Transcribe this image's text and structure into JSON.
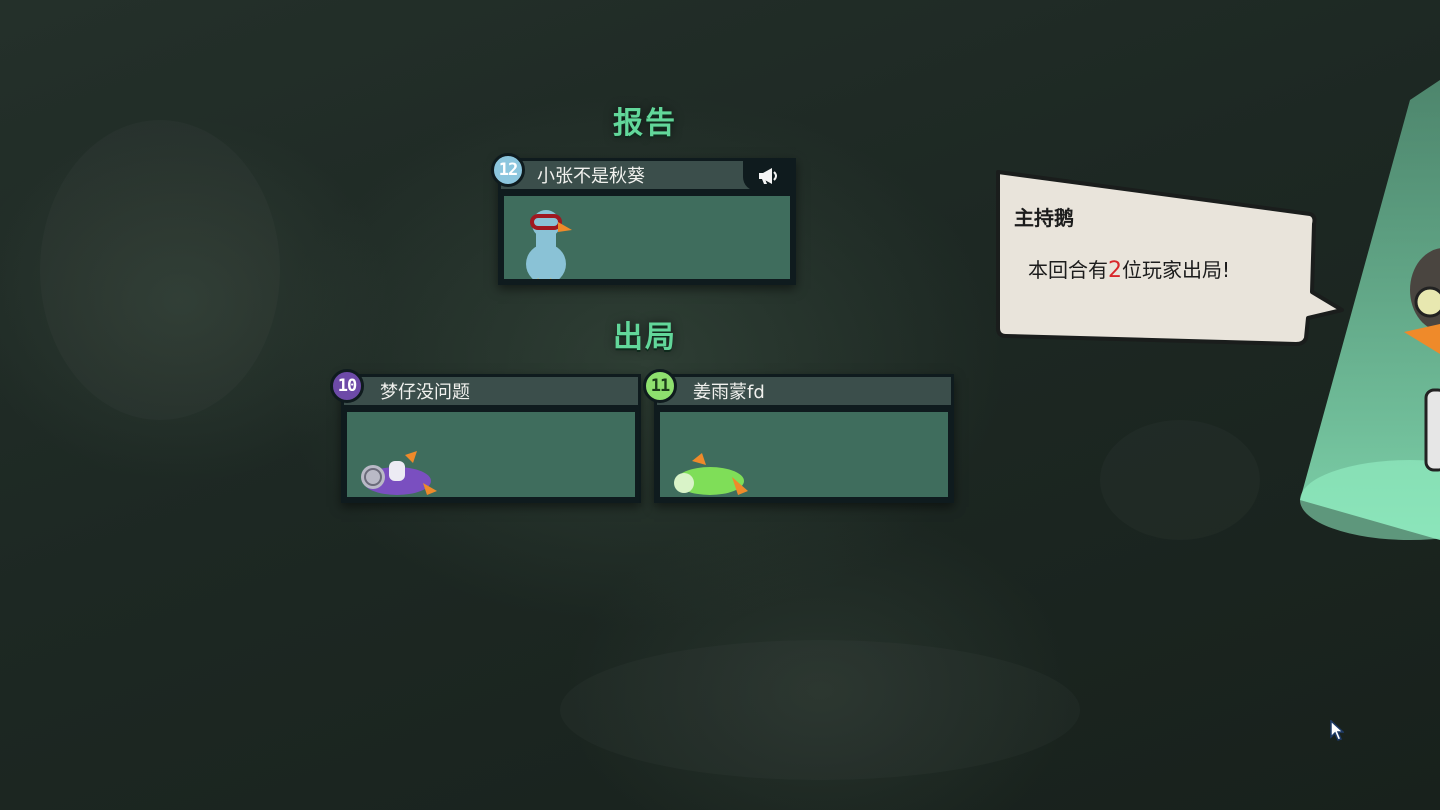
{
  "sections": {
    "report_title": "报告",
    "out_title": "出局"
  },
  "reporter": {
    "number": "12",
    "name": "小张不是秋葵",
    "badge_color": "#8cc6de"
  },
  "eliminated": [
    {
      "number": "10",
      "name": "梦仔没问题",
      "badge_color": "#6d4aa8",
      "badge_text_color": "#ffffff",
      "body_color": "#7a4fc0"
    },
    {
      "number": "11",
      "name": "姜雨蒙fd",
      "badge_color": "#8ee06e",
      "badge_text_color": "#1c3d1a",
      "body_color": "#7fde58"
    }
  ],
  "host": {
    "name": "主持鹅",
    "message_prefix": "本回合有",
    "message_count": "2",
    "message_suffix": "位玩家出局!"
  },
  "colors": {
    "heading": "#62d79a",
    "card_header": "#3b4e4b",
    "card_body": "#3f6d5d",
    "highlight_number": "#d8262a"
  },
  "icons": [
    "megaphone-icon",
    "cursor-icon"
  ]
}
